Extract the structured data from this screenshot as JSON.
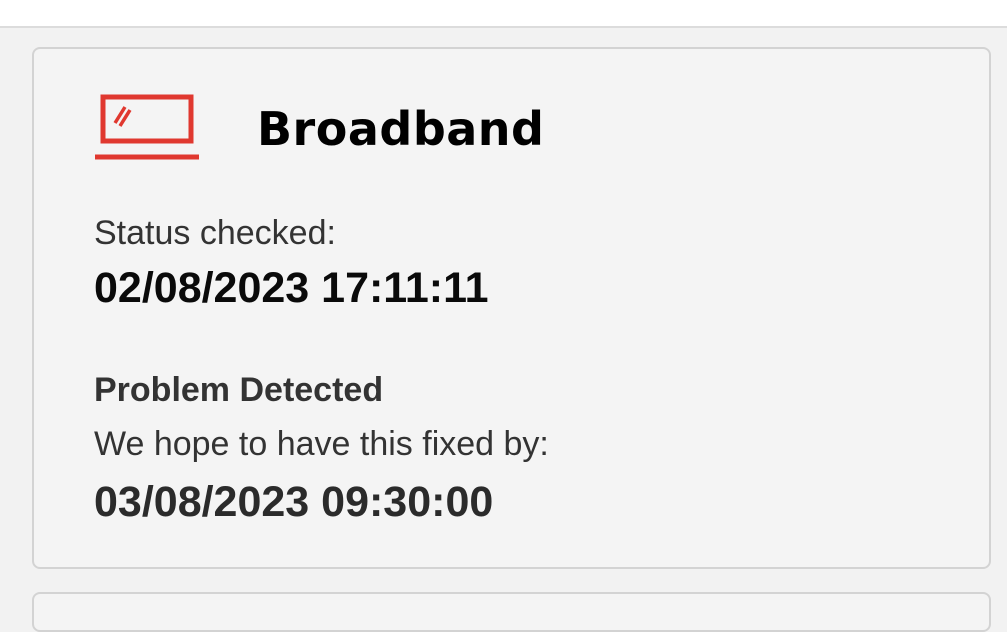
{
  "card": {
    "icon": "broadband-laptop-icon",
    "title": "Broadband",
    "status_checked_label": "Status checked:",
    "status_checked_value": "02/08/2023 17:11:11",
    "problem_heading": "Problem Detected",
    "fix_label": "We hope to have this fixed by:",
    "fix_value": "03/08/2023 09:30:00"
  },
  "colors": {
    "icon_accent": "#e0382f",
    "page_background": "#f2f2f2",
    "card_border": "#d3d3d3"
  }
}
